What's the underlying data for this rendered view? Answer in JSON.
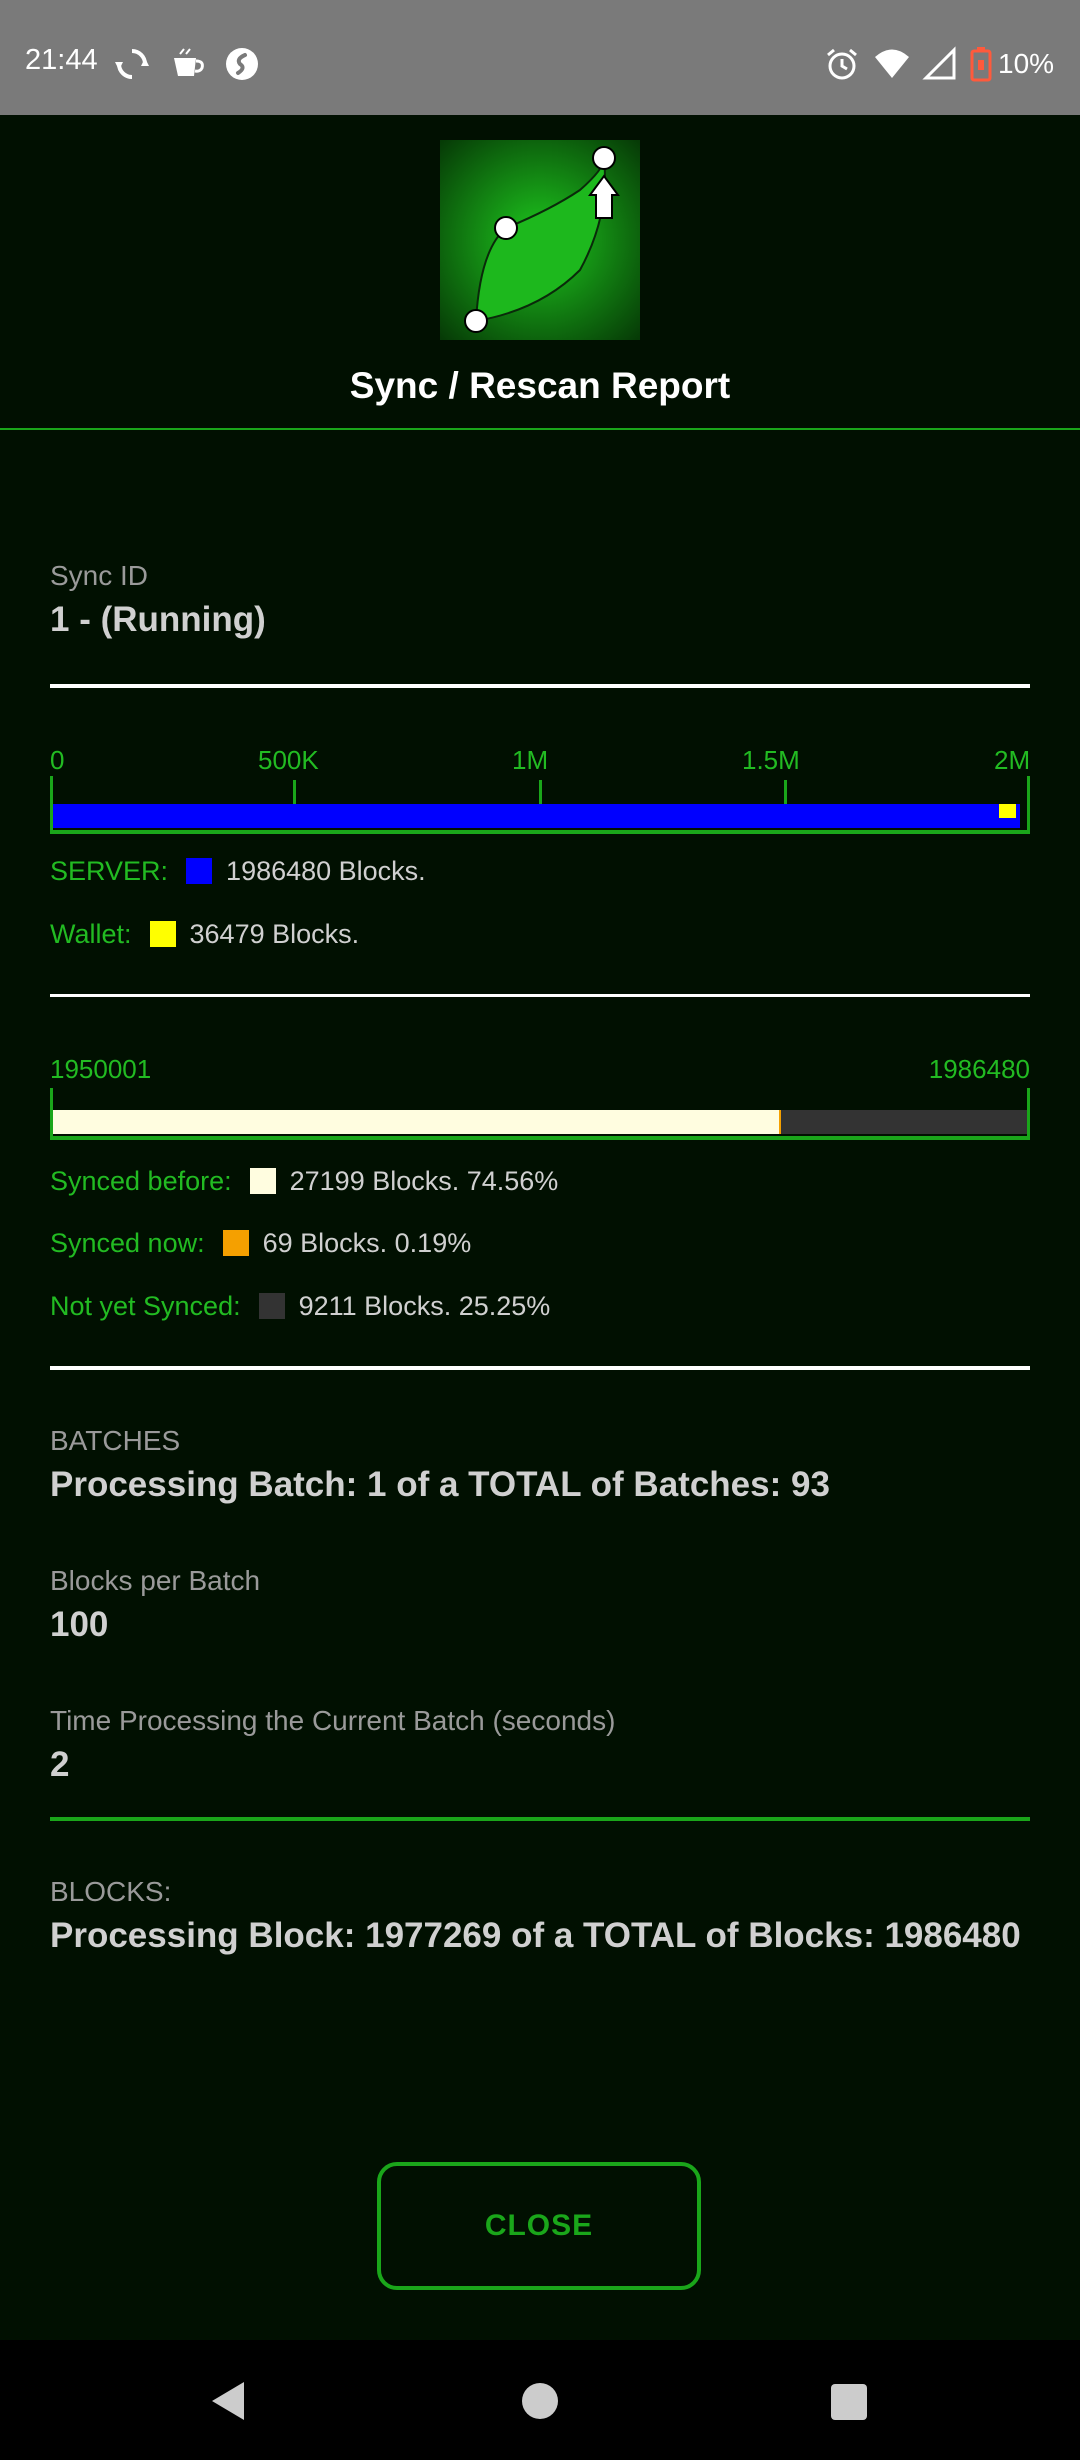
{
  "status_bar": {
    "time": "21:44",
    "battery_pct": "10%",
    "left_icons": [
      "sync-icon",
      "cup-icon",
      "shazam-icon"
    ],
    "right_icons": [
      "alarm-icon",
      "wifi-icon",
      "signal-icon",
      "battery-icon"
    ]
  },
  "header": {
    "title": "Sync / Rescan Report"
  },
  "sync": {
    "label": "Sync ID",
    "value": "1 - (Running)"
  },
  "server_bar": {
    "ticks": [
      "0",
      "500K",
      "1M",
      "1.5M",
      "2M"
    ],
    "max": 2000000,
    "server_blocks": 1986480,
    "wallet_blocks": 36479,
    "server_label": "SERVER:",
    "server_value": "1986480 Blocks.",
    "wallet_label": "Wallet:",
    "wallet_value": "36479 Blocks."
  },
  "range_bar": {
    "start_label": "1950001",
    "end_label": "1986480",
    "synced_before_pct": 74.56,
    "synced_now_pct": 0.19,
    "not_synced_pct": 25.25,
    "synced_before_label": "Synced before:",
    "synced_before_value": "27199 Blocks. 74.56%",
    "synced_now_label": "Synced now:",
    "synced_now_value": "69 Blocks. 0.19%",
    "not_synced_label": "Not yet Synced:",
    "not_synced_value": "9211 Blocks. 25.25%"
  },
  "batches": {
    "label": "BATCHES",
    "value": "Processing Batch: 1 of a TOTAL of Batches: 93",
    "per_batch_label": "Blocks per Batch",
    "per_batch_value": "100",
    "time_label": "Time Processing the Current Batch (seconds)",
    "time_value": "2"
  },
  "blocks": {
    "label": "BLOCKS:",
    "value": "Processing Block: 1977269 of a TOTAL of Blocks: 1986480"
  },
  "close_button": {
    "label": "CLOSE"
  },
  "colors": {
    "accent": "#1aa61a",
    "server": "#0000ff",
    "wallet": "#ffff00",
    "synced_before": "#fffde0",
    "synced_now": "#f5a000",
    "not_synced": "#333333"
  }
}
